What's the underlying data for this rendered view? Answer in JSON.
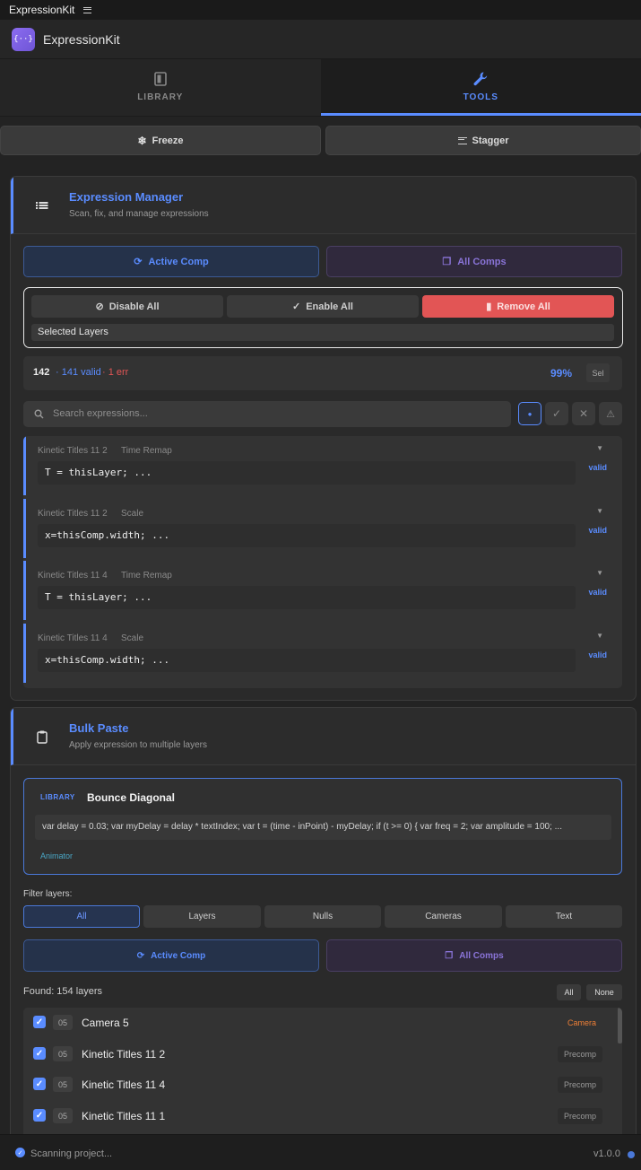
{
  "topbar": {
    "title": "ExpressionKit"
  },
  "app": {
    "logo": "{··}",
    "name": "ExpressionKit"
  },
  "tabs": [
    {
      "label": "LIBRARY",
      "icon": "book-icon",
      "active": false
    },
    {
      "label": "TOOLS",
      "icon": "wrench-icon",
      "active": true
    }
  ],
  "tools": {
    "freeze": "Freeze",
    "stagger": "Stagger"
  },
  "expression_manager": {
    "title": "Expression Manager",
    "subtitle": "Scan, fix, and manage expressions",
    "scope_active": "Active Comp",
    "scope_all": "All Comps",
    "disable_all": "Disable All",
    "enable_all": "Enable All",
    "remove_all": "Remove All",
    "target": "Selected Layers",
    "stats": {
      "total": "142",
      "valid": "· 141 valid",
      "err": "· 1 err",
      "percent": "99%",
      "sel": "Sel"
    },
    "search_placeholder": "Search expressions...",
    "items": [
      {
        "layer": "Kinetic Titles 11 2",
        "prop": "Time Remap",
        "code": "T = thisLayer; ...",
        "status": "valid"
      },
      {
        "layer": "Kinetic Titles 11 2",
        "prop": "Scale",
        "code": "x=thisComp.width; ...",
        "status": "valid"
      },
      {
        "layer": "Kinetic Titles 11 4",
        "prop": "Time Remap",
        "code": "T = thisLayer; ...",
        "status": "valid"
      },
      {
        "layer": "Kinetic Titles 11 4",
        "prop": "Scale",
        "code": "x=thisComp.width; ...",
        "status": "valid"
      }
    ]
  },
  "bulk_paste": {
    "title": "Bulk Paste",
    "subtitle": "Apply expression to multiple layers",
    "card": {
      "badge": "LIBRARY",
      "name": "Bounce Diagonal",
      "code": "var delay = 0.03; var myDelay = delay * textIndex; var t = (time - inPoint) - myDelay; if (t >= 0) { var freq = 2; var amplitude = 100; ...",
      "tag": "Animator"
    },
    "filter_label": "Filter layers:",
    "filters": [
      "All",
      "Layers",
      "Nulls",
      "Cameras",
      "Text"
    ],
    "scope_active": "Active Comp",
    "scope_all": "All Comps",
    "found": "Found: 154 layers",
    "btn_all": "All",
    "btn_none": "None",
    "layers": [
      {
        "num": "05",
        "name": "Camera 5",
        "type": "Camera"
      },
      {
        "num": "05",
        "name": "Kinetic Titles 11 2",
        "type": "Precomp"
      },
      {
        "num": "05",
        "name": "Kinetic Titles 11 4",
        "type": "Precomp"
      },
      {
        "num": "05",
        "name": "Kinetic Titles 11 1",
        "type": "Precomp"
      }
    ]
  },
  "status": {
    "text": "Scanning project...",
    "version": "v1.0.0"
  },
  "colors": {
    "accent": "#5a8cff",
    "purple": "#8a74d8",
    "danger": "#e25555",
    "camera": "#ef7f36"
  }
}
